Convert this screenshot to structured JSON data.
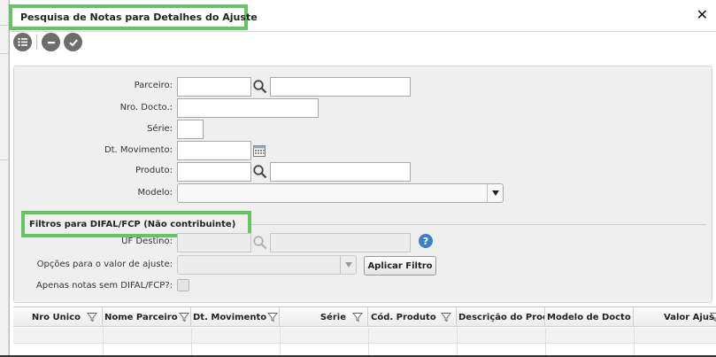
{
  "dialog": {
    "title": "Pesquisa de Notas para Detalhes do Ajuste",
    "close_icon": "close-icon"
  },
  "toolbar": {
    "buttons": [
      {
        "name": "list-options-icon"
      },
      {
        "name": "minus-icon"
      },
      {
        "name": "check-icon"
      }
    ]
  },
  "filters": {
    "parceiro_label": "Parceiro:",
    "nro_docto_label": "Nro. Docto.:",
    "serie_label": "Série:",
    "dt_movimento_label": "Dt. Movimento:",
    "produto_label": "Produto:",
    "modelo_label": "Modelo:"
  },
  "difal": {
    "section_title": "Filtros para DIFAL/FCP (Não contribuinte)",
    "uf_destino_label": "UF Destino:",
    "opcoes_label": "Opções para o valor de ajuste:",
    "apply_button": "Aplicar Filtro",
    "apenas_label": "Apenas notas sem DIFAL/FCP?:",
    "help_text": "?"
  },
  "grid": {
    "columns": [
      {
        "label": "Nro Único"
      },
      {
        "label": "Nome Parceiro"
      },
      {
        "label": "Dt. Movimento"
      },
      {
        "label": "Série"
      },
      {
        "label": "Cód. Produto"
      },
      {
        "label": "Descrição do Produto"
      },
      {
        "label": "Modelo de Docto"
      },
      {
        "label": "Valor Ajuste"
      }
    ]
  },
  "colors": {
    "highlight_green": "#67c462",
    "help_blue": "#3b7fc8",
    "panel_bg": "#efefef"
  }
}
